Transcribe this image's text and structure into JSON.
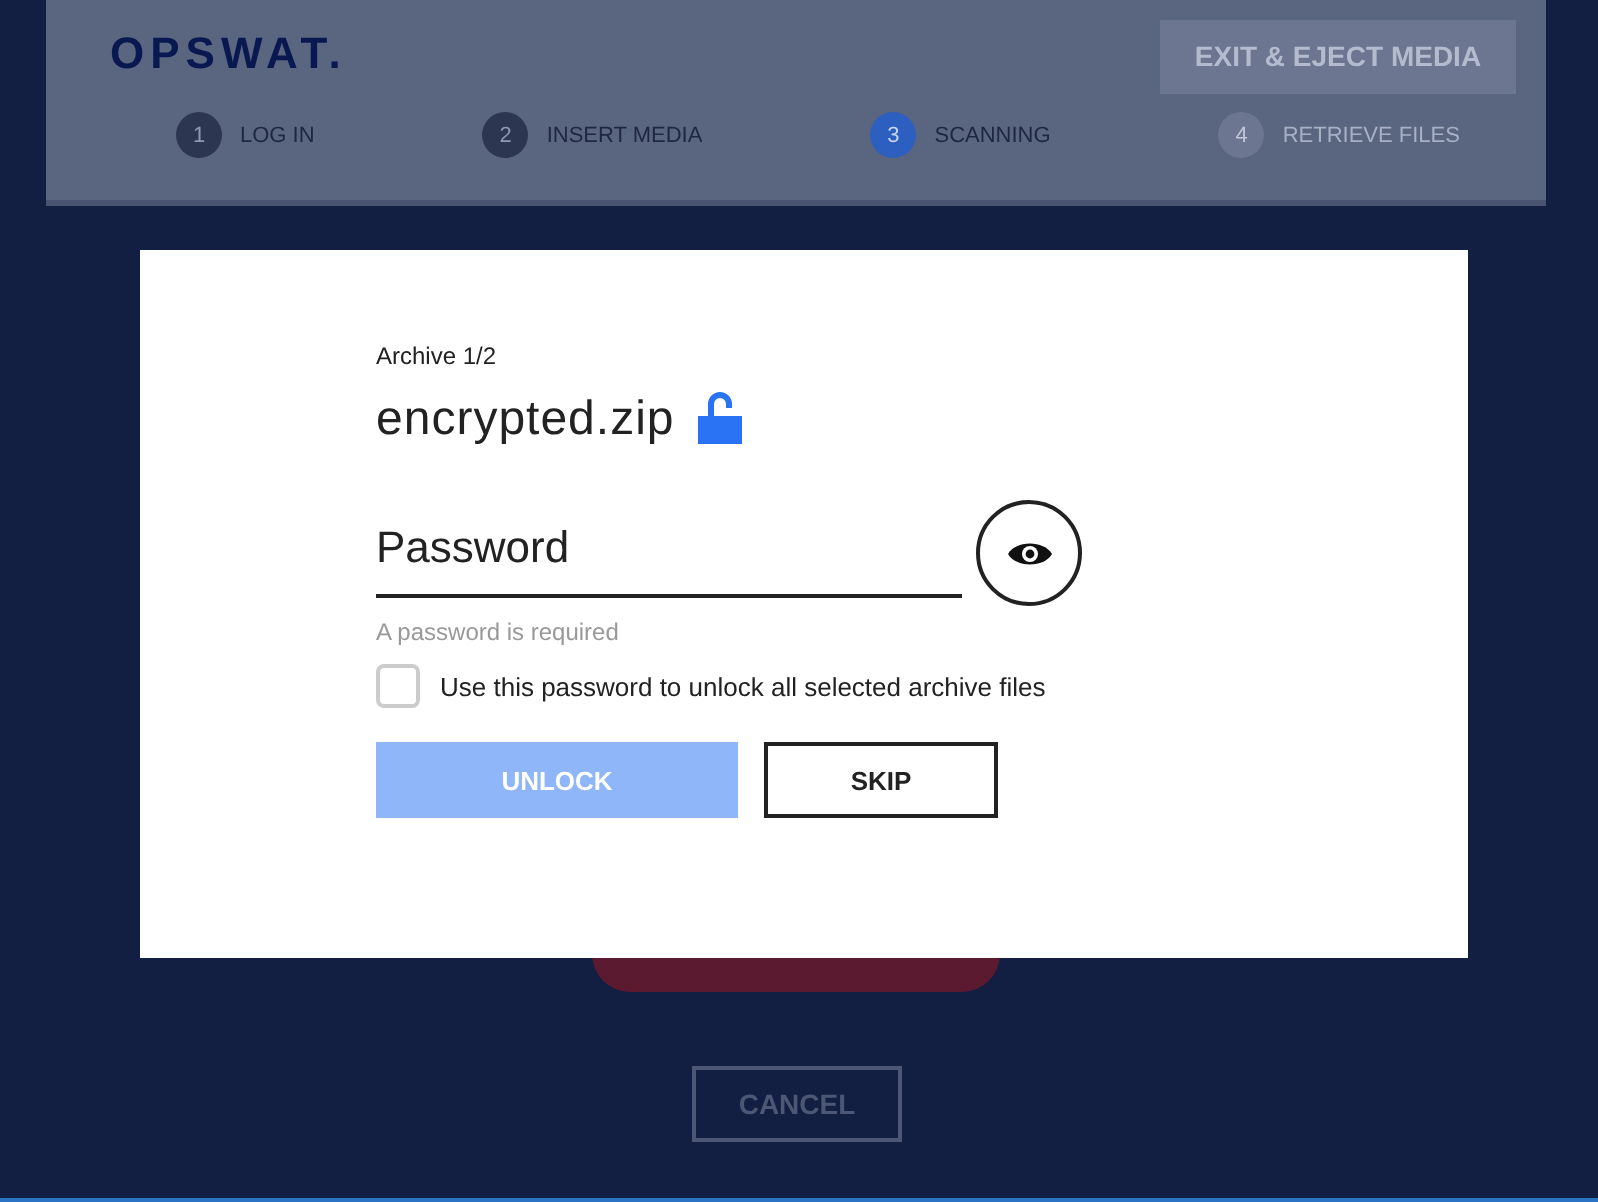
{
  "header": {
    "logo": "OPSWAT.",
    "exit_button": "EXIT & EJECT MEDIA"
  },
  "steps": [
    {
      "number": "1",
      "label": "LOG IN",
      "selected": false,
      "disabled": false
    },
    {
      "number": "2",
      "label": "INSERT MEDIA",
      "selected": false,
      "disabled": false
    },
    {
      "number": "3",
      "label": "SCANNING",
      "selected": true,
      "disabled": false
    },
    {
      "number": "4",
      "label": "RETRIEVE FILES",
      "selected": false,
      "disabled": true
    }
  ],
  "cancel_button": "CANCEL",
  "dialog": {
    "counter": "Archive 1/2",
    "filename": "encrypted.zip",
    "password": {
      "placeholder": "Password"
    },
    "hint": "A password is required",
    "apply_all": {
      "label": "Use this password to unlock all selected archive files",
      "checked": false
    },
    "unlock_button": {
      "label": "UNLOCK",
      "disabled": true
    },
    "skip_button": "SKIP"
  }
}
